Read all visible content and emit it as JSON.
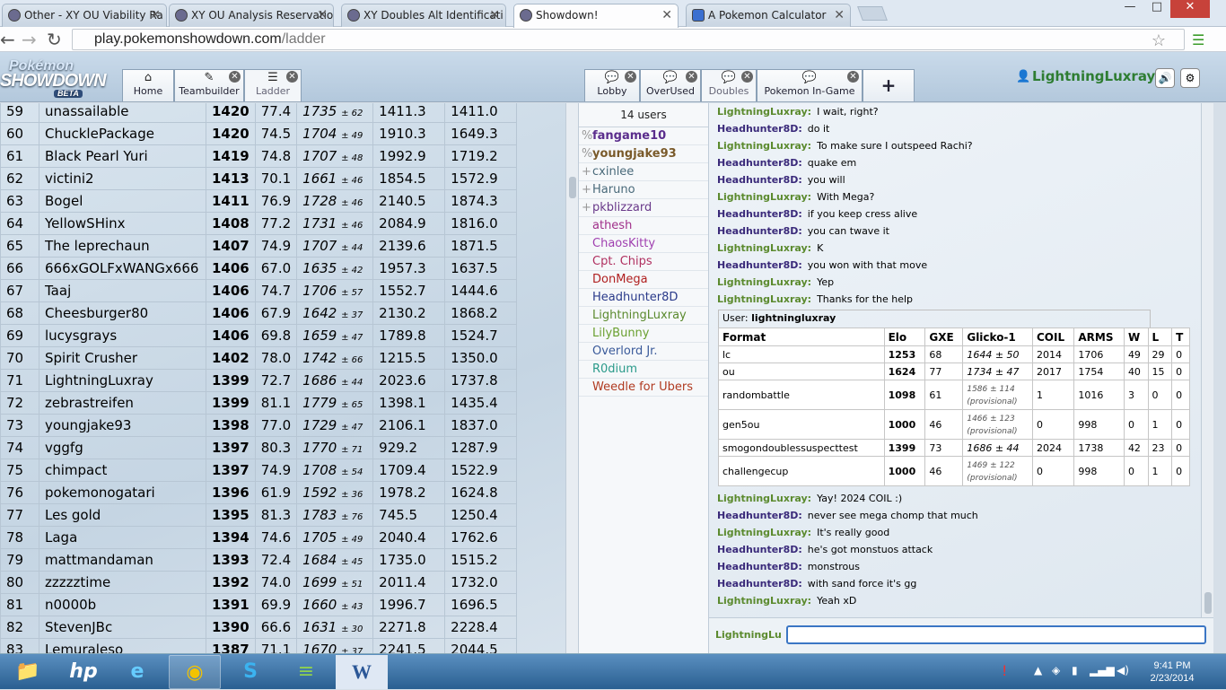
{
  "browser": {
    "tabs": [
      {
        "title": "Other - XY OU Viability Ra",
        "active": false
      },
      {
        "title": "XY OU Analysis Reservatio",
        "active": false
      },
      {
        "title": "XY Doubles Alt Identificati",
        "active": false
      },
      {
        "title": "Showdown!",
        "active": true
      },
      {
        "title": "A Pokemon Calculator",
        "active": false
      }
    ],
    "url_host": "play.pokemonshowdown.com",
    "url_path": "/ladder",
    "window_controls": {
      "minimize": "—",
      "maximize": "□",
      "close": "✕"
    }
  },
  "header": {
    "logo": {
      "line1": "Pokémon",
      "line2": "SHOWDOWN",
      "badge": "BETA"
    },
    "left_tabs": [
      {
        "label": "Home",
        "icon": "home-icon",
        "glyph": "⌂"
      },
      {
        "label": "Teambuilder",
        "icon": "pencil-icon",
        "glyph": "✎"
      },
      {
        "label": "Ladder",
        "icon": "list-icon",
        "glyph": "☰"
      }
    ],
    "room_tabs": [
      {
        "label": "Lobby",
        "icon": "chat-bubble-icon"
      },
      {
        "label": "OverUsed",
        "icon": "chat-bubble-icon"
      },
      {
        "label": "Doubles",
        "icon": "chat-bubble-icon"
      },
      {
        "label": "Pokemon In-Game",
        "icon": "chat-bubble-icon"
      }
    ],
    "add_room": "+",
    "username": "LightningLuxray",
    "sound_icon": "🔊",
    "settings_icon": "⚙"
  },
  "ladder": {
    "rows": [
      {
        "rank": "59",
        "name": "unassailable",
        "elo": "1420",
        "gxe": "77.4",
        "glicko": "1735",
        "dev": "± 62",
        "c1": "1411.3",
        "c2": "1411.0"
      },
      {
        "rank": "60",
        "name": "ChucklePackage",
        "elo": "1420",
        "gxe": "74.5",
        "glicko": "1704",
        "dev": "± 49",
        "c1": "1910.3",
        "c2": "1649.3"
      },
      {
        "rank": "61",
        "name": "Black Pearl Yuri",
        "elo": "1419",
        "gxe": "74.8",
        "glicko": "1707",
        "dev": "± 48",
        "c1": "1992.9",
        "c2": "1719.2"
      },
      {
        "rank": "62",
        "name": "victini2",
        "elo": "1413",
        "gxe": "70.1",
        "glicko": "1661",
        "dev": "± 46",
        "c1": "1854.5",
        "c2": "1572.9"
      },
      {
        "rank": "63",
        "name": "Bogel",
        "elo": "1411",
        "gxe": "76.9",
        "glicko": "1728",
        "dev": "± 46",
        "c1": "2140.5",
        "c2": "1874.3"
      },
      {
        "rank": "64",
        "name": "YellowSHinx",
        "elo": "1408",
        "gxe": "77.2",
        "glicko": "1731",
        "dev": "± 46",
        "c1": "2084.9",
        "c2": "1816.0"
      },
      {
        "rank": "65",
        "name": "The leprechaun",
        "elo": "1407",
        "gxe": "74.9",
        "glicko": "1707",
        "dev": "± 44",
        "c1": "2139.6",
        "c2": "1871.5"
      },
      {
        "rank": "66",
        "name": "666xGOLFxWANGx666",
        "elo": "1406",
        "gxe": "67.0",
        "glicko": "1635",
        "dev": "± 42",
        "c1": "1957.3",
        "c2": "1637.5"
      },
      {
        "rank": "67",
        "name": "Taaj",
        "elo": "1406",
        "gxe": "74.7",
        "glicko": "1706",
        "dev": "± 57",
        "c1": "1552.7",
        "c2": "1444.6"
      },
      {
        "rank": "68",
        "name": "Cheesburger80",
        "elo": "1406",
        "gxe": "67.9",
        "glicko": "1642",
        "dev": "± 37",
        "c1": "2130.2",
        "c2": "1868.2"
      },
      {
        "rank": "69",
        "name": "lucysgrays",
        "elo": "1406",
        "gxe": "69.8",
        "glicko": "1659",
        "dev": "± 47",
        "c1": "1789.8",
        "c2": "1524.7"
      },
      {
        "rank": "70",
        "name": "Spirit Crusher",
        "elo": "1402",
        "gxe": "78.0",
        "glicko": "1742",
        "dev": "± 66",
        "c1": "1215.5",
        "c2": "1350.0"
      },
      {
        "rank": "71",
        "name": "LightningLuxray",
        "elo": "1399",
        "gxe": "72.7",
        "glicko": "1686",
        "dev": "± 44",
        "c1": "2023.6",
        "c2": "1737.8"
      },
      {
        "rank": "72",
        "name": "zebrastreifen",
        "elo": "1399",
        "gxe": "81.1",
        "glicko": "1779",
        "dev": "± 65",
        "c1": "1398.1",
        "c2": "1435.4"
      },
      {
        "rank": "73",
        "name": "youngjake93",
        "elo": "1398",
        "gxe": "77.0",
        "glicko": "1729",
        "dev": "± 47",
        "c1": "2106.1",
        "c2": "1837.0"
      },
      {
        "rank": "74",
        "name": "vggfg",
        "elo": "1397",
        "gxe": "80.3",
        "glicko": "1770",
        "dev": "± 71",
        "c1": "929.2",
        "c2": "1287.9"
      },
      {
        "rank": "75",
        "name": "chimpact",
        "elo": "1397",
        "gxe": "74.9",
        "glicko": "1708",
        "dev": "± 54",
        "c1": "1709.4",
        "c2": "1522.9"
      },
      {
        "rank": "76",
        "name": "pokemonogatari",
        "elo": "1396",
        "gxe": "61.9",
        "glicko": "1592",
        "dev": "± 36",
        "c1": "1978.2",
        "c2": "1624.8"
      },
      {
        "rank": "77",
        "name": "Les gold",
        "elo": "1395",
        "gxe": "81.3",
        "glicko": "1783",
        "dev": "± 76",
        "c1": "745.5",
        "c2": "1250.4"
      },
      {
        "rank": "78",
        "name": "Laga",
        "elo": "1394",
        "gxe": "74.6",
        "glicko": "1705",
        "dev": "± 49",
        "c1": "2040.4",
        "c2": "1762.6"
      },
      {
        "rank": "79",
        "name": "mattmandaman",
        "elo": "1393",
        "gxe": "72.4",
        "glicko": "1684",
        "dev": "± 45",
        "c1": "1735.0",
        "c2": "1515.2"
      },
      {
        "rank": "80",
        "name": "zzzzztime",
        "elo": "1392",
        "gxe": "74.0",
        "glicko": "1699",
        "dev": "± 51",
        "c1": "2011.4",
        "c2": "1732.0"
      },
      {
        "rank": "81",
        "name": "n0000b",
        "elo": "1391",
        "gxe": "69.9",
        "glicko": "1660",
        "dev": "± 43",
        "c1": "1996.7",
        "c2": "1696.5"
      },
      {
        "rank": "82",
        "name": "StevenJBc",
        "elo": "1390",
        "gxe": "66.6",
        "glicko": "1631",
        "dev": "± 30",
        "c1": "2271.8",
        "c2": "2228.4"
      },
      {
        "rank": "83",
        "name": "Lemuraleso",
        "elo": "1387",
        "gxe": "71.1",
        "glicko": "1670",
        "dev": "± 37",
        "c1": "2241.5",
        "c2": "2044.5"
      }
    ]
  },
  "userlist": {
    "count": "14 users",
    "users": [
      {
        "group": "%",
        "name": "fangame10",
        "color": "#5a2d8c",
        "bold": true
      },
      {
        "group": "%",
        "name": "youngjake93",
        "color": "#7a5a2a",
        "bold": true
      },
      {
        "group": "+",
        "name": "cxinlee",
        "color": "#4a6a7a",
        "bold": false
      },
      {
        "group": "+",
        "name": "Haruno",
        "color": "#4a6a7a",
        "bold": false
      },
      {
        "group": "+",
        "name": "pkblizzard",
        "color": "#6a3a8a",
        "bold": false
      },
      {
        "group": "",
        "name": "athesh",
        "color": "#a0308a",
        "bold": false
      },
      {
        "group": "",
        "name": "ChaosKitty",
        "color": "#a040b0",
        "bold": false
      },
      {
        "group": "",
        "name": "Cpt. Chips",
        "color": "#b03060",
        "bold": false
      },
      {
        "group": "",
        "name": "DonMega",
        "color": "#b02020",
        "bold": false
      },
      {
        "group": "",
        "name": "Headhunter8D",
        "color": "#2a3a8a",
        "bold": false
      },
      {
        "group": "",
        "name": "LightningLuxray",
        "color": "#5b8a2e",
        "bold": false
      },
      {
        "group": "",
        "name": "LilyBunny",
        "color": "#6aa030",
        "bold": false
      },
      {
        "group": "",
        "name": "Overlord Jr.",
        "color": "#3a5a9a",
        "bold": false
      },
      {
        "group": "",
        "name": "R0dium",
        "color": "#2a9a8a",
        "bold": false
      },
      {
        "group": "",
        "name": "Weedle for Ubers",
        "color": "#b03a20",
        "bold": false
      }
    ]
  },
  "chat": {
    "before": [
      {
        "user": "LightningLuxray:",
        "msg": "I wait, right?",
        "who": "l"
      },
      {
        "user": "Headhunter8D:",
        "msg": "do it",
        "who": "h"
      },
      {
        "user": "LightningLuxray:",
        "msg": "To make sure I outspeed Rachi?",
        "who": "l"
      },
      {
        "user": "Headhunter8D:",
        "msg": "quake em",
        "who": "h"
      },
      {
        "user": "Headhunter8D:",
        "msg": "you will",
        "who": "h"
      },
      {
        "user": "LightningLuxray:",
        "msg": "With Mega?",
        "who": "l"
      },
      {
        "user": "Headhunter8D:",
        "msg": "if you keep cress alive",
        "who": "h"
      },
      {
        "user": "Headhunter8D:",
        "msg": "you can twave it",
        "who": "h"
      },
      {
        "user": "LightningLuxray:",
        "msg": "K",
        "who": "l"
      },
      {
        "user": "Headhunter8D:",
        "msg": "you won with that move",
        "who": "h"
      },
      {
        "user": "LightningLuxray:",
        "msg": "Yep",
        "who": "l"
      },
      {
        "user": "LightningLuxray:",
        "msg": "Thanks for the help",
        "who": "l"
      }
    ],
    "rank_user_label": "User:",
    "rank_user": "lightningluxray",
    "rank_headers": [
      "Format",
      "Elo",
      "GXE",
      "Glicko-1",
      "COIL",
      "ARMS",
      "W",
      "L",
      "T"
    ],
    "rank_rows": [
      {
        "format": "lc",
        "elo": "1253",
        "gxe": "68",
        "glicko": "1644 ± 50",
        "prov": "",
        "coil": "2014",
        "arms": "1706",
        "w": "49",
        "l": "29",
        "t": "0"
      },
      {
        "format": "ou",
        "elo": "1624",
        "gxe": "77",
        "glicko": "1734 ± 47",
        "prov": "",
        "coil": "2017",
        "arms": "1754",
        "w": "40",
        "l": "15",
        "t": "0"
      },
      {
        "format": "randombattle",
        "elo": "1098",
        "gxe": "61",
        "glicko": "1586 ± 114",
        "prov": "(provisional)",
        "coil": "1",
        "arms": "1016",
        "w": "3",
        "l": "0",
        "t": "0"
      },
      {
        "format": "gen5ou",
        "elo": "1000",
        "gxe": "46",
        "glicko": "1466 ± 123",
        "prov": "(provisional)",
        "coil": "0",
        "arms": "998",
        "w": "0",
        "l": "1",
        "t": "0"
      },
      {
        "format": "smogondoublessuspecttest",
        "elo": "1399",
        "gxe": "73",
        "glicko": "1686 ± 44",
        "prov": "",
        "coil": "2024",
        "arms": "1738",
        "w": "42",
        "l": "23",
        "t": "0"
      },
      {
        "format": "challengecup",
        "elo": "1000",
        "gxe": "46",
        "glicko": "1469 ± 122",
        "prov": "(provisional)",
        "coil": "0",
        "arms": "998",
        "w": "0",
        "l": "1",
        "t": "0"
      }
    ],
    "after": [
      {
        "user": "LightningLuxray:",
        "msg": "Yay! 2024 COIL :)",
        "who": "l"
      },
      {
        "user": "Headhunter8D:",
        "msg": "never see mega chomp that much",
        "who": "h"
      },
      {
        "user": "LightningLuxray:",
        "msg": "It's really good",
        "who": "l"
      },
      {
        "user": "Headhunter8D:",
        "msg": "he's got monstuos attack",
        "who": "h"
      },
      {
        "user": "Headhunter8D:",
        "msg": "monstrous",
        "who": "h"
      },
      {
        "user": "Headhunter8D:",
        "msg": "with sand force it's gg",
        "who": "h"
      },
      {
        "user": "LightningLuxray:",
        "msg": "Yeah xD",
        "who": "l"
      }
    ],
    "input_name": "LightningLu",
    "input_value": ""
  },
  "taskbar": {
    "apps": [
      {
        "name": "file-explorer-icon",
        "glyph": "📁"
      },
      {
        "name": "hp-icon",
        "glyph": "hp"
      },
      {
        "name": "internet-explorer-icon",
        "glyph": "e"
      },
      {
        "name": "chrome-icon",
        "glyph": "◉"
      },
      {
        "name": "skype-icon",
        "glyph": "S"
      },
      {
        "name": "spotify-icon",
        "glyph": "≡"
      },
      {
        "name": "word-icon",
        "glyph": "W"
      }
    ],
    "time": "9:41 PM",
    "date": "2/23/2014"
  }
}
